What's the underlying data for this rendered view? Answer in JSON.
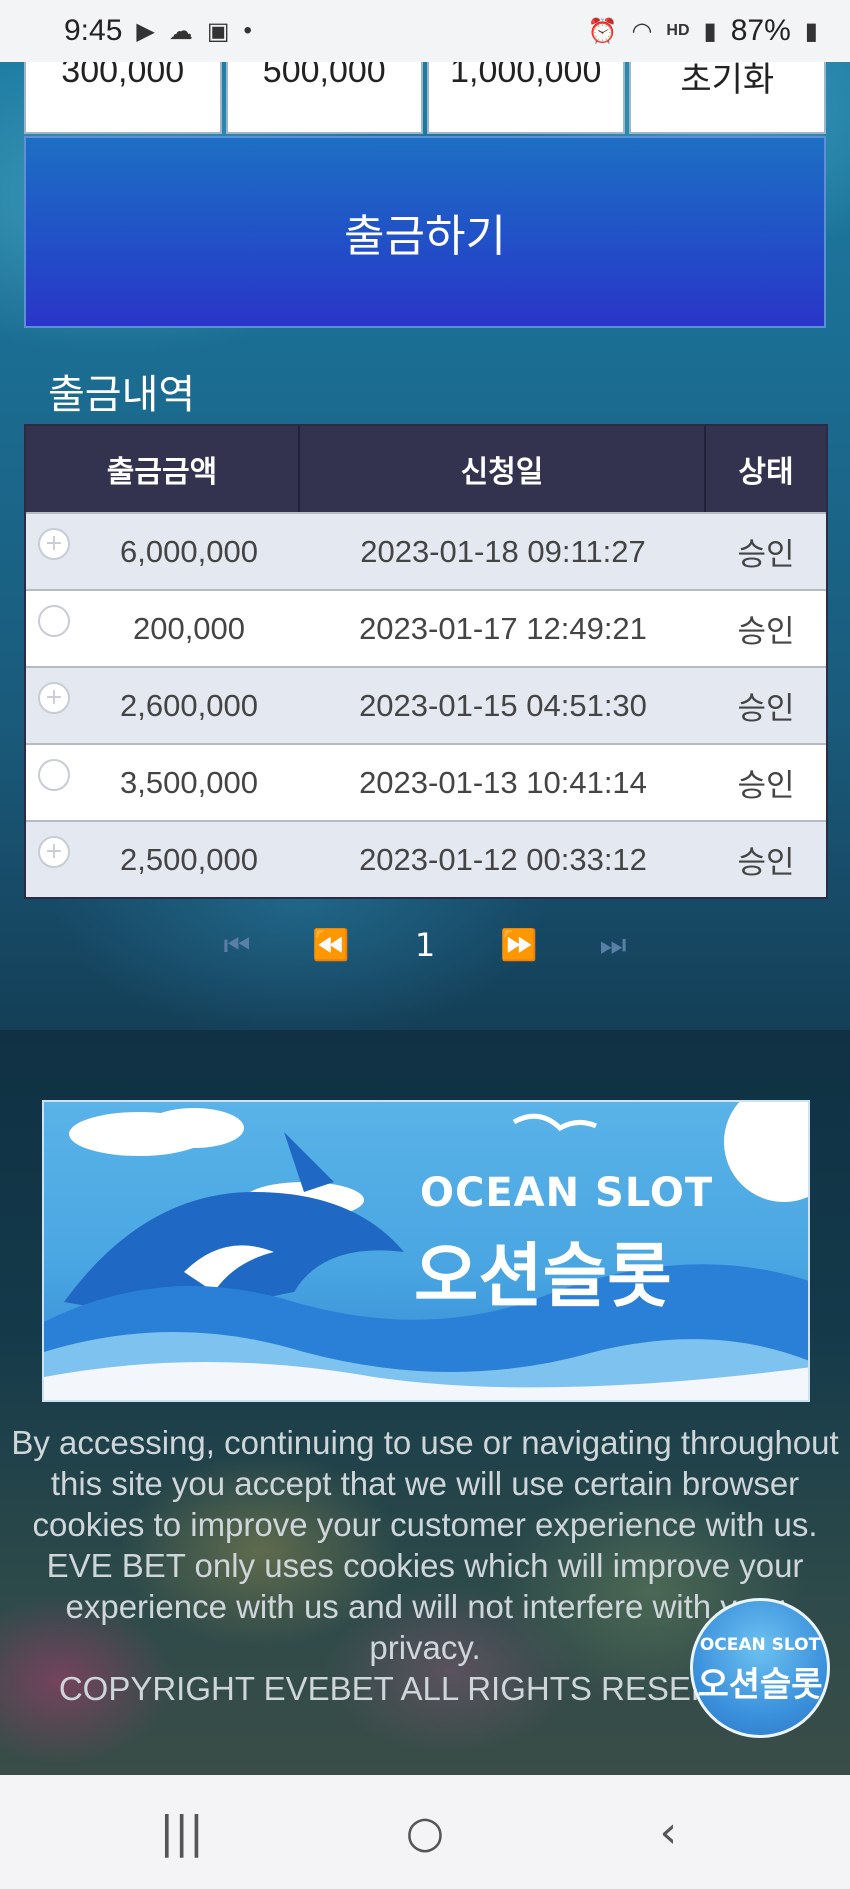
{
  "status_bar": {
    "time": "9:45",
    "battery": "87%",
    "icons_left": [
      "youtube-icon",
      "cloud-icon",
      "gallery-icon",
      "dot-icon"
    ],
    "icons_right": [
      "alarm-icon",
      "wifi-icon",
      "hd-voice-icon",
      "signal-icon",
      "battery-icon"
    ]
  },
  "amounts": [
    "300,000",
    "500,000",
    "1,000,000",
    "초기화"
  ],
  "withdraw_button": "출금하기",
  "history": {
    "title": "출금내역",
    "headers": [
      "출금금액",
      "신청일",
      "상태"
    ],
    "rows": [
      {
        "amount": "6,000,000",
        "date": "2023-01-18 09:11:27",
        "status": "승인"
      },
      {
        "amount": "200,000",
        "date": "2023-01-17 12:49:21",
        "status": "승인"
      },
      {
        "amount": "2,600,000",
        "date": "2023-01-15 04:51:30",
        "status": "승인"
      },
      {
        "amount": "3,500,000",
        "date": "2023-01-13 10:41:14",
        "status": "승인"
      },
      {
        "amount": "2,500,000",
        "date": "2023-01-12 00:33:12",
        "status": "승인"
      }
    ]
  },
  "pagination": {
    "first": "⏮",
    "prev": "⏪",
    "current": "1",
    "next": "⏩",
    "last": "⏭"
  },
  "banner": {
    "title_en": "OCEAN SLOT",
    "title_ko": "오션슬롯"
  },
  "footer": {
    "line1": "By accessing, continuing to use or navigating throughout this site you accept that we will use certain browser cookies to improve your customer experience with us.",
    "line2": "EVE BET only uses cookies which will improve your experience with us and will not interfere with your privacy.",
    "copyright": "COPYRIGHT EVEBET ALL RIGHTS RESERVED."
  },
  "badge": {
    "title_en": "OCEAN SLOT",
    "title_ko": "오션슬롯"
  },
  "nav": {
    "recents": "|||",
    "home": "○",
    "back": "‹"
  },
  "colors": {
    "button_blue": "#2150c7",
    "table_header": "#33334f",
    "row_alt": "#e4e8f0"
  }
}
